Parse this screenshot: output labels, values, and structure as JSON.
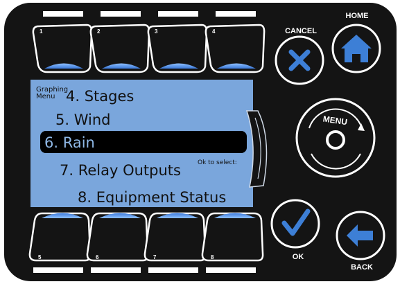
{
  "function_keys_top": [
    {
      "number": "1"
    },
    {
      "number": "2"
    },
    {
      "number": "3"
    },
    {
      "number": "4"
    }
  ],
  "function_keys_bottom": [
    {
      "number": "5"
    },
    {
      "number": "6"
    },
    {
      "number": "7"
    },
    {
      "number": "8"
    }
  ],
  "buttons": {
    "cancel_label": "CANCEL",
    "home_label": "HOME",
    "ok_label": "OK",
    "back_label": "BACK",
    "menu_label": "MENU"
  },
  "screen": {
    "title_line1": "Graphing",
    "title_line2": "Menu",
    "items": [
      {
        "label": "4. Stages"
      },
      {
        "label": "5. Wind"
      },
      {
        "label": "6. Rain",
        "selected": true
      },
      {
        "label": "7. Relay Outputs"
      },
      {
        "label": "8. Equipment Status"
      }
    ],
    "hint": "Ok to select:"
  },
  "icons": {
    "cancel": "x-icon",
    "home": "house-icon",
    "ok": "checkmark-icon",
    "back": "arrow-left-icon",
    "menu": "circle-icon"
  },
  "colors": {
    "bezel": "#141414",
    "screen": "#7aa6dc",
    "selection": "#000000",
    "button_blue": "#3d7fd6",
    "key_indicator": "#4f8de6"
  }
}
